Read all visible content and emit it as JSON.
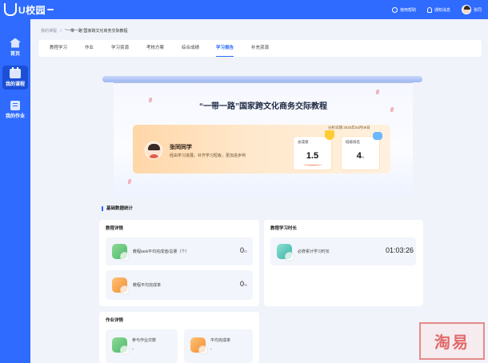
{
  "brand": {
    "name": "U校园",
    "tag": ""
  },
  "header": {
    "help_label": "使用帮助",
    "notice_label": "通知消息",
    "user_name": "张同"
  },
  "sidebar": {
    "items": [
      {
        "label": "首页",
        "icon": "home-icon"
      },
      {
        "label": "我的课程",
        "icon": "course-icon",
        "active": true
      },
      {
        "label": "我的作业",
        "icon": "homework-icon"
      }
    ]
  },
  "breadcrumb": {
    "root": "我的课程",
    "sep": "/",
    "current": "“一带一路”国家跨文化商务交际教程"
  },
  "tabs": [
    {
      "label": "教程学习"
    },
    {
      "label": "作业"
    },
    {
      "label": "学习资源"
    },
    {
      "label": "考核方案"
    },
    {
      "label": "综合成绩"
    },
    {
      "label": "学习报告",
      "active": true
    },
    {
      "label": "补充资源"
    }
  ],
  "report": {
    "title": "“一带一路”国家跨文化商务交际教程",
    "date": "分析日期  2025年04月09日",
    "student_name": "张同同学",
    "student_desc": "经由学习进展，补齐学习短板，更加进步哟",
    "total_score_label": "总成绩",
    "total_score_value": "1.5",
    "rank_label": "班级排名",
    "rank_value": "4",
    "rank_unit": "/8"
  },
  "basic_stats": {
    "section_title": "基础数据统计",
    "course_panel": {
      "title": "教程详情",
      "items": [
        {
          "label": "教程task平均完成值/总量（个）",
          "value": "0",
          "unit": "/0"
        },
        {
          "label": "教程平均完成率",
          "value": "0",
          "unit": "%"
        }
      ]
    },
    "time_panel": {
      "title": "教程学习时长",
      "item": {
        "label": "必修累计学习时长",
        "value": "01:03:26"
      }
    },
    "homework_panel": {
      "title": "作业详情",
      "items": [
        {
          "label": "参与作业次数",
          "value": "-"
        },
        {
          "label": "平均完成率",
          "value": "-"
        }
      ]
    }
  },
  "watermark": {
    "text": "淘易"
  },
  "colors": {
    "primary": "#2f6bff",
    "accent_orange": "#ffd7a8"
  }
}
